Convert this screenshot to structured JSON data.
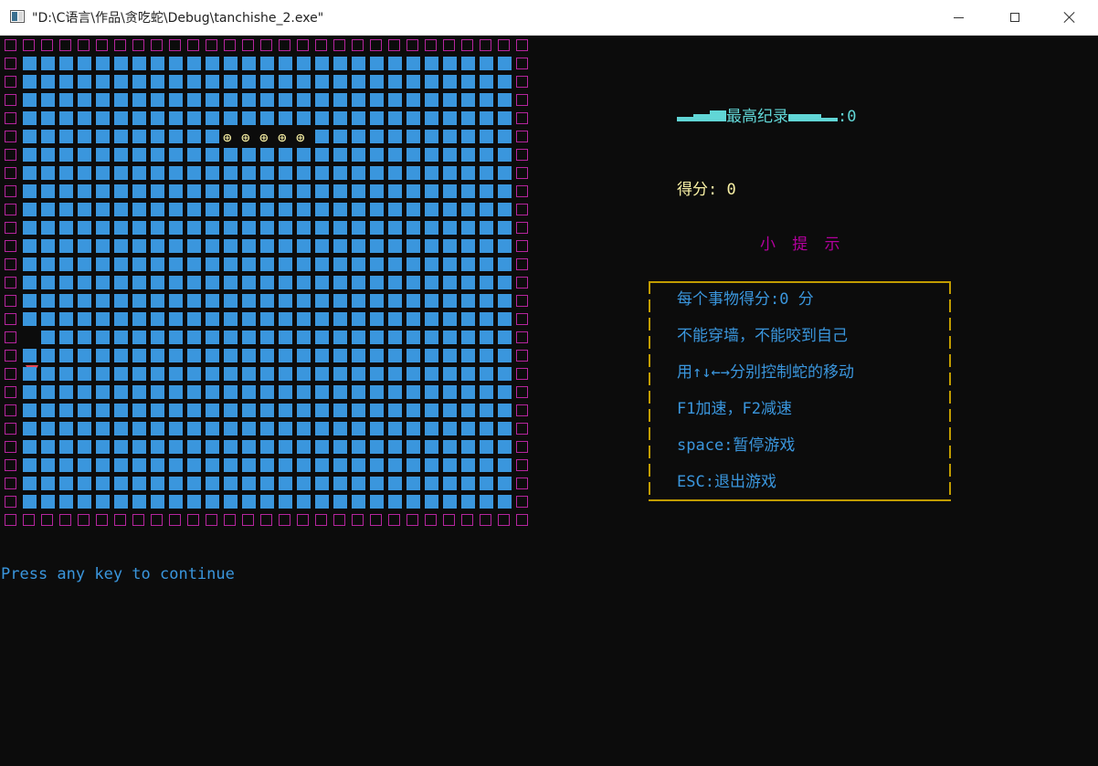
{
  "window": {
    "title": "\"D:\\C语言\\作品\\贪吃蛇\\Debug\\tanchishe_2.exe\"",
    "controls": {
      "minimize": "minimize-icon",
      "maximize": "maximize-icon",
      "close": "close-icon"
    }
  },
  "game": {
    "grid_columns": 29,
    "grid_rows": 27,
    "snake_glyph": "⊕",
    "snake_length": 5,
    "food_glyph": "▼"
  },
  "sidebar": {
    "record_label": "最高纪录",
    "record_value": ":0",
    "score_text": "得分: 0",
    "hint_title": "小 提 示",
    "tips": [
      "每个事物得分:0 分",
      "不能穿墙，不能咬到自己",
      "用↑↓←→分别控制蛇的移动",
      "F1加速，F2减速",
      "space:暂停游戏",
      "ESC:退出游戏"
    ]
  },
  "console": {
    "continue_text": "Press any key to continue"
  },
  "colors": {
    "background": "#0c0c0c",
    "wall": "#b6259e",
    "floor": "#3a96dd",
    "snake": "#f9f1a5",
    "food": "#e74856",
    "record": "#61d6d6",
    "score": "#f9f1a5",
    "hint_title": "#b4009e",
    "tips": "#3a96dd",
    "tip_border": "#c19c00"
  }
}
